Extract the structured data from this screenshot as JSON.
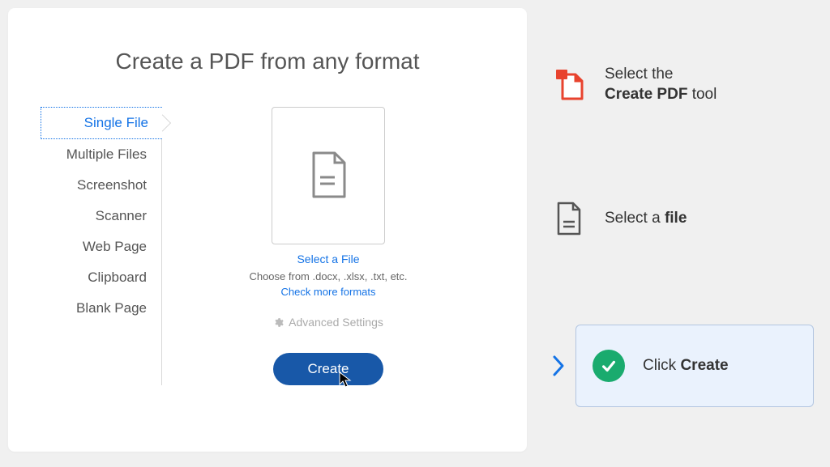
{
  "panel": {
    "title": "Create a PDF from any format",
    "tabs": [
      "Single File",
      "Multiple Files",
      "Screenshot",
      "Scanner",
      "Web Page",
      "Clipboard",
      "Blank Page"
    ],
    "select_file_link": "Select a File",
    "hint": "Choose from .docx, .xlsx, .txt, etc.",
    "check_formats": "Check more formats",
    "advanced_settings": "Advanced Settings",
    "create_button": "Create"
  },
  "steps": {
    "one_prefix": "Select the ",
    "one_bold": "Create PDF",
    "one_suffix": " tool",
    "two_prefix": "Select a ",
    "two_bold": "file",
    "three_prefix": "Click ",
    "three_bold": "Create"
  }
}
